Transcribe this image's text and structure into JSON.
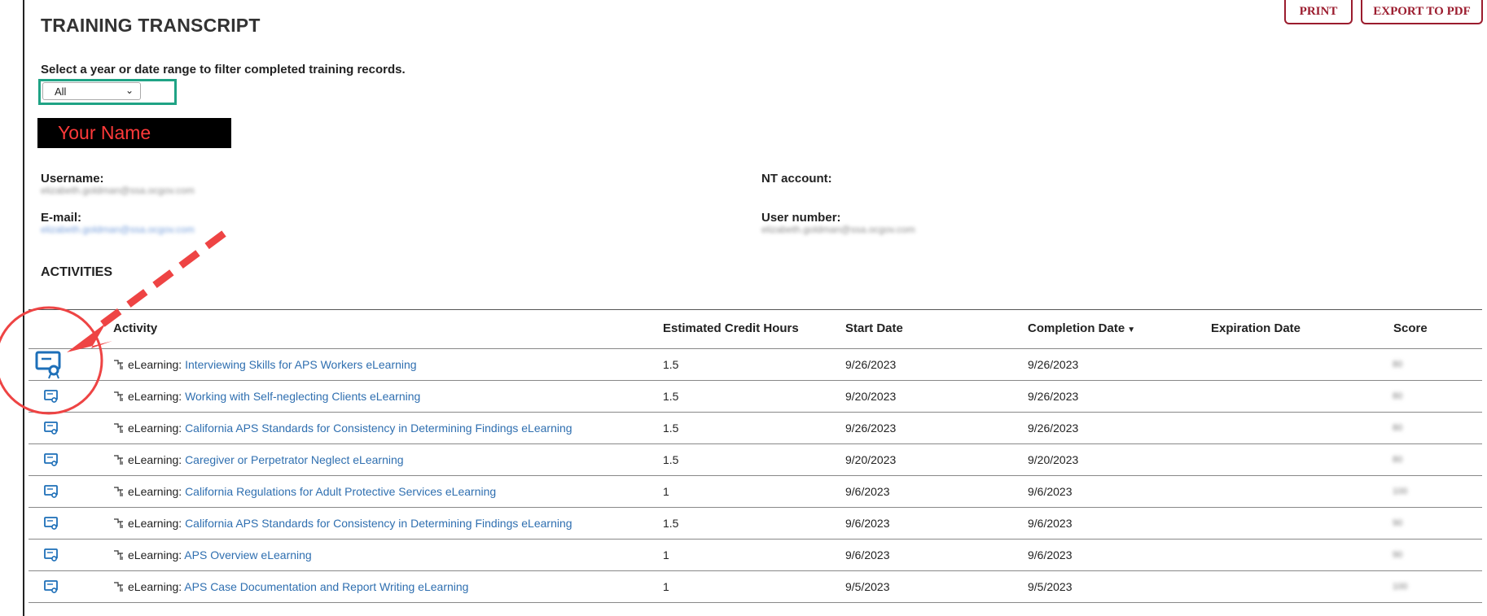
{
  "page": {
    "title": "TRAINING TRANSCRIPT"
  },
  "toolbar": {
    "print_label": "PRINT",
    "export_label": "EXPORT TO PDF"
  },
  "filter": {
    "label": "Select a year or date range to filter completed training records.",
    "selected": "All"
  },
  "user": {
    "name_redaction": "Your Name",
    "username_label": "Username:",
    "username_value": "elizabeth.goldman@ssa.ocgov.com",
    "email_label": "E-mail:",
    "email_value": "elizabeth.goldman@ssa.ocgov.com",
    "nt_account_label": "NT account:",
    "user_number_label": "User number:",
    "user_number_value": "elizabeth.goldman@ssa.ocgov.com"
  },
  "activities": {
    "title": "ACTIVITIES",
    "columns": [
      "Activity",
      "Estimated Credit Hours",
      "Start Date",
      "Completion Date",
      "Expiration Date",
      "Score"
    ],
    "sort_column": "Completion Date",
    "rows": [
      {
        "type": "eLearning:",
        "name": "Interviewing Skills for APS Workers eLearning",
        "hours": "1.5",
        "start": "9/26/2023",
        "completed": "9/26/2023",
        "expiration": "",
        "score": "80"
      },
      {
        "type": "eLearning:",
        "name": "Working with Self-neglecting Clients eLearning",
        "hours": "1.5",
        "start": "9/20/2023",
        "completed": "9/26/2023",
        "expiration": "",
        "score": "80"
      },
      {
        "type": "eLearning:",
        "name": "California APS Standards for Consistency in Determining Findings eLearning",
        "hours": "1.5",
        "start": "9/26/2023",
        "completed": "9/26/2023",
        "expiration": "",
        "score": "80"
      },
      {
        "type": "eLearning:",
        "name": "Caregiver or Perpetrator Neglect eLearning",
        "hours": "1.5",
        "start": "9/20/2023",
        "completed": "9/20/2023",
        "expiration": "",
        "score": "80"
      },
      {
        "type": "eLearning:",
        "name": "California Regulations for Adult Protective Services eLearning",
        "hours": "1",
        "start": "9/6/2023",
        "completed": "9/6/2023",
        "expiration": "",
        "score": "100"
      },
      {
        "type": "eLearning:",
        "name": "California APS Standards for Consistency in Determining Findings eLearning",
        "hours": "1.5",
        "start": "9/6/2023",
        "completed": "9/6/2023",
        "expiration": "",
        "score": "90"
      },
      {
        "type": "eLearning:",
        "name": "APS Overview eLearning",
        "hours": "1",
        "start": "9/6/2023",
        "completed": "9/6/2023",
        "expiration": "",
        "score": "90"
      },
      {
        "type": "eLearning:",
        "name": "APS Case Documentation and Report Writing eLearning",
        "hours": "1",
        "start": "9/5/2023",
        "completed": "9/5/2023",
        "expiration": "",
        "score": "100"
      }
    ]
  },
  "icons": {
    "certificate": "certificate-icon",
    "curriculum": "fork-icon"
  },
  "colors": {
    "accent_red": "#9b1c2e",
    "link_blue": "#2f6fb0",
    "filter_highlight": "#1fa385",
    "annotation_red": "#ee4444"
  }
}
